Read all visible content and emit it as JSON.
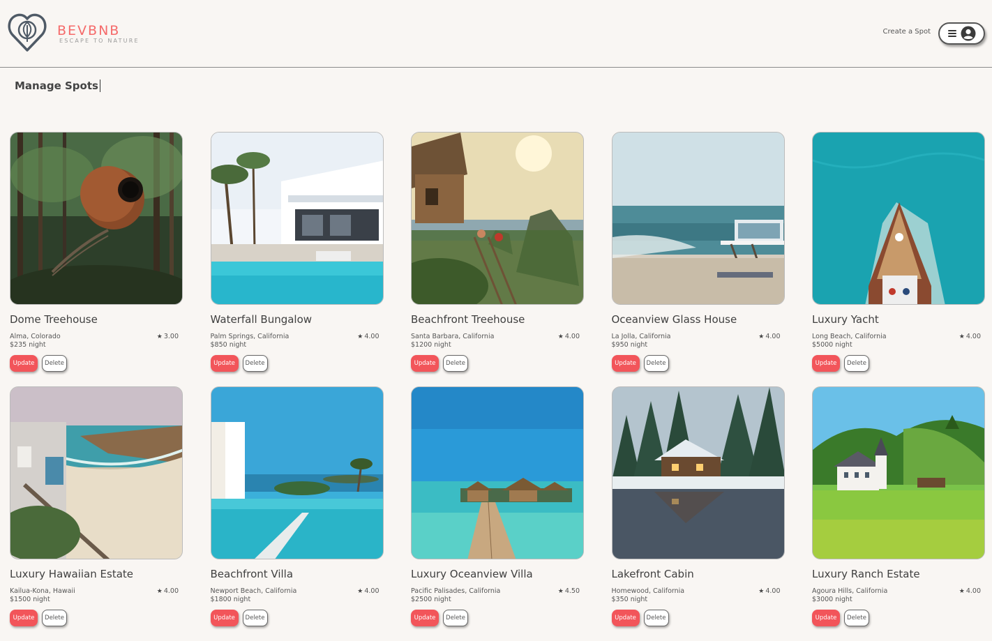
{
  "brand": {
    "name": "BEVBNB",
    "tagline": "ESCAPE TO NATURE",
    "accent_color": "#f56a6a"
  },
  "nav": {
    "create_spot": "Create a Spot",
    "menu_icon": "hamburger-icon",
    "profile_icon": "user-circle-icon"
  },
  "page": {
    "title": "Manage Spots"
  },
  "actions": {
    "update_label": "Update",
    "delete_label": "Delete"
  },
  "spots": [
    {
      "name": "Dome Treehouse",
      "location": "Alma, Colorado",
      "price": "$235 night",
      "rating": "3.00",
      "scene": "forest-treehouse"
    },
    {
      "name": "Waterfall Bungalow",
      "location": "Palm Springs, California",
      "price": "$850 night",
      "rating": "4.00",
      "scene": "modern-villa-pool"
    },
    {
      "name": "Beachfront Treehouse",
      "location": "Santa Barbara, California",
      "price": "$1200 night",
      "rating": "4.00",
      "scene": "cliff-treehouse"
    },
    {
      "name": "Oceanview Glass House",
      "location": "La Jolla, California",
      "price": "$950 night",
      "rating": "4.00",
      "scene": "beach-glass-house"
    },
    {
      "name": "Luxury Yacht",
      "location": "Long Beach, California",
      "price": "$5000 night",
      "rating": "4.00",
      "scene": "yacht-aerial"
    },
    {
      "name": "Luxury Hawaiian Estate",
      "location": "Kailua-Kona, Hawaii",
      "price": "$1500 night",
      "rating": "4.00",
      "scene": "coastal-estate"
    },
    {
      "name": "Beachfront Villa",
      "location": "Newport Beach, California",
      "price": "$1800 night",
      "rating": "4.00",
      "scene": "infinity-pool"
    },
    {
      "name": "Luxury Oceanview Villa",
      "location": "Pacific Palisades, California",
      "price": "$2500 night",
      "rating": "4.50",
      "scene": "overwater-bungalow"
    },
    {
      "name": "Lakefront Cabin",
      "location": "Homewood, California",
      "price": "$350 night",
      "rating": "4.00",
      "scene": "snow-lake-cabin"
    },
    {
      "name": "Luxury Ranch Estate",
      "location": "Agoura Hills, California",
      "price": "$3000 night",
      "rating": "4.00",
      "scene": "meadow-chateau"
    }
  ]
}
